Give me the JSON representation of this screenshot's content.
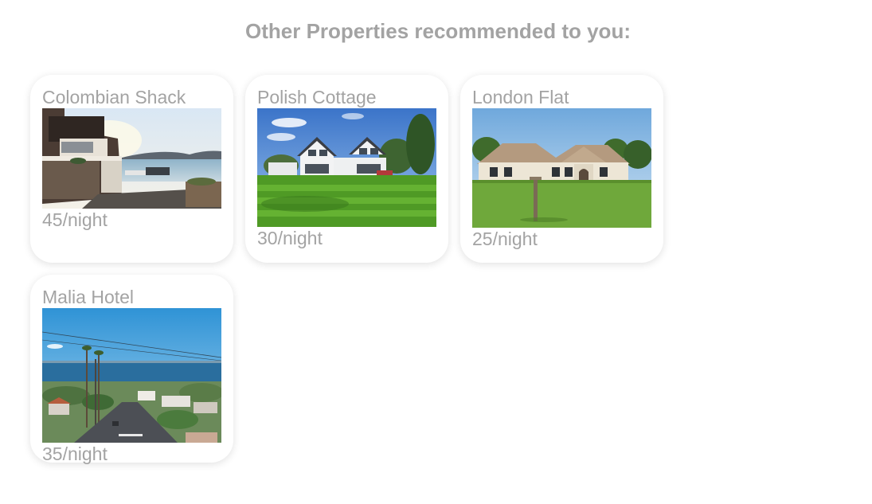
{
  "heading": "Other Properties recommended to you:",
  "properties": [
    {
      "name": "Colombian Shack",
      "price": "45/night",
      "image_icon": "seaside-terrace-house-photo"
    },
    {
      "name": "Polish Cottage",
      "price": "30/night",
      "image_icon": "gabled-white-cottage-photo"
    },
    {
      "name": "London Flat",
      "price": "25/night",
      "image_icon": "single-story-house-lawn-photo"
    },
    {
      "name": "Malia Hotel",
      "price": "35/night",
      "image_icon": "coastal-town-street-photo"
    }
  ],
  "colors": {
    "text": "#a3a3a3",
    "card_bg": "#ffffff"
  }
}
